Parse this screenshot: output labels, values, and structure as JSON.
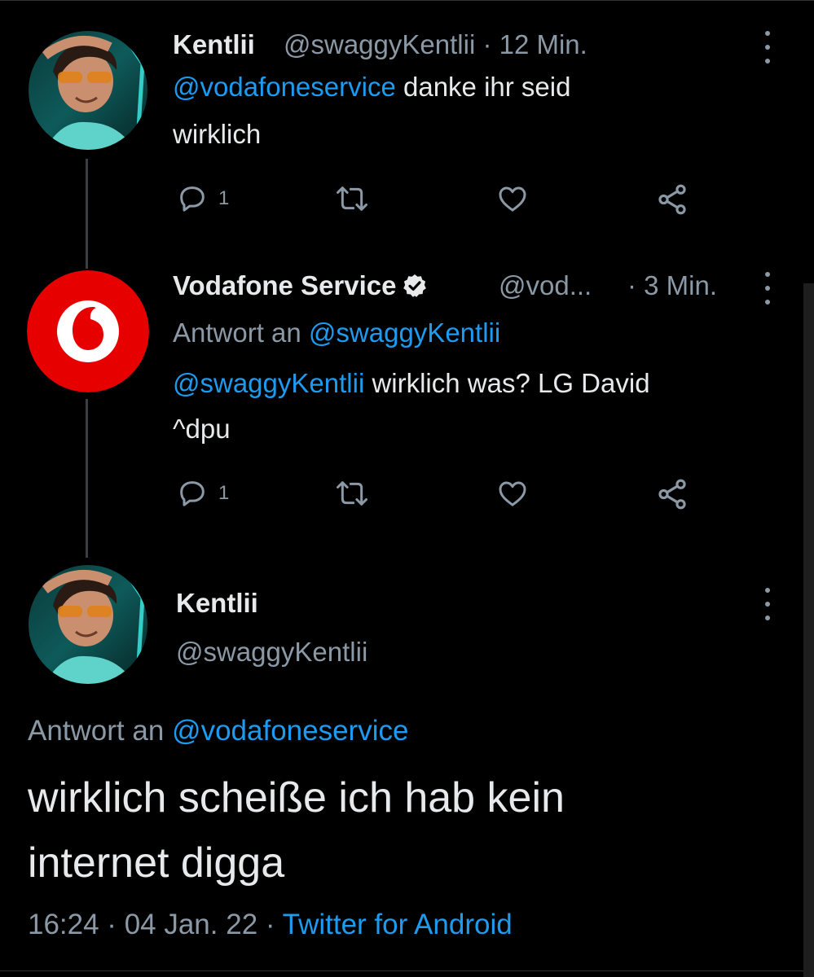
{
  "tweet1": {
    "name": "Kentlii",
    "handle": "@swaggyKentlii",
    "time": "· 12 Min.",
    "mention": "@vodafoneservice",
    "text_line1_rest": " danke ihr seid",
    "text_line2": "wirklich",
    "reply_count": "1"
  },
  "tweet2": {
    "name": "Vodafone Service",
    "handle": "@vod...",
    "time": "· 3 Min.",
    "reply_prefix": "Antwort an ",
    "reply_to": "@swaggyKentlii",
    "mention": "@swaggyKentlii",
    "text_line1_rest": " wirklich was? LG David",
    "text_line2": "^dpu",
    "reply_count": "1"
  },
  "tweet3": {
    "name": "Kentlii",
    "handle": "@swaggyKentlii",
    "reply_prefix": "Antwort an ",
    "reply_to": "@vodafoneservice",
    "text_line1": "wirklich scheiße ich hab kein",
    "text_line2": "internet digga",
    "timestamp": "16:24 · 04 Jan. 22 · ",
    "source": "Twitter for Android"
  },
  "colors": {
    "background": "#000000",
    "text": "#e7e9ea",
    "secondary": "#8b98a5",
    "link": "#1d9bf0",
    "vodafone_red": "#e60000"
  },
  "icons": {
    "reply": "reply-icon",
    "retweet": "retweet-icon",
    "like": "heart-icon",
    "share": "share-icon",
    "more": "more-icon",
    "verified": "verified-badge-icon"
  }
}
